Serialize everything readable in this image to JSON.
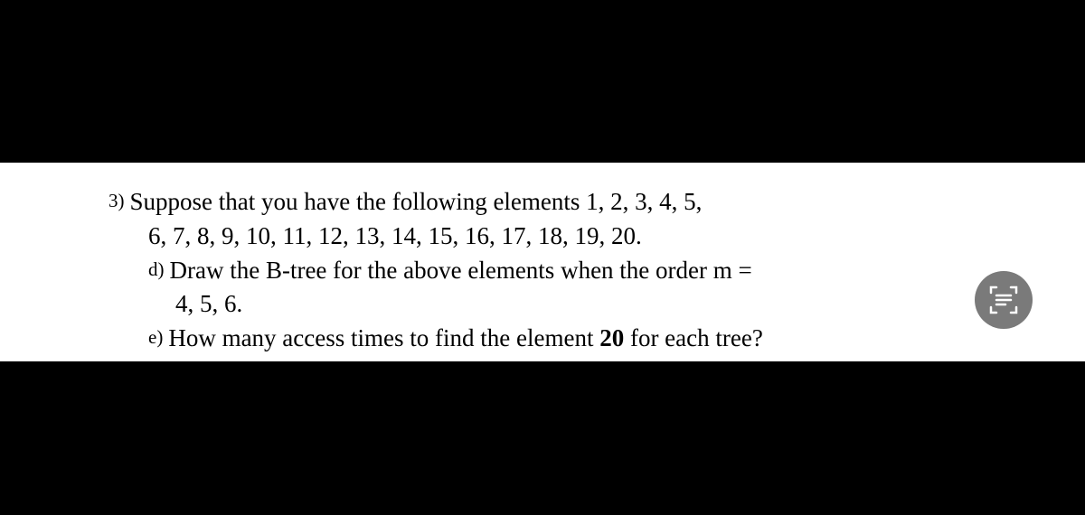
{
  "question": {
    "number": "3)",
    "intro_line1": "Suppose that you have the following elements 1, 2, 3, 4, 5,",
    "intro_line2": "6, 7, 8, 9, 10, 11, 12, 13, 14, 15, 16, 17, 18, 19, 20.",
    "parts": [
      {
        "marker": "d)",
        "text_line1": "Draw the B-tree for the above elements when the order m =",
        "text_line2": "4, 5, 6."
      },
      {
        "marker": "e)",
        "text_prefix": "How many access times to find the element ",
        "bold_value": "20",
        "text_suffix": " for each tree?"
      }
    ]
  },
  "icons": {
    "scan": "scan-icon"
  }
}
